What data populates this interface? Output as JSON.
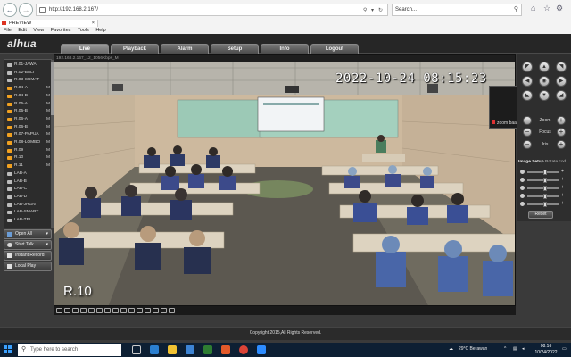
{
  "browser": {
    "url": "http://192.168.2.167/",
    "search_placeholder": "Search...",
    "tab_title": "PREVIEW",
    "menu": [
      "File",
      "Edit",
      "View",
      "Favorites",
      "Tools",
      "Help"
    ]
  },
  "app": {
    "logo": "alhua",
    "nav_tabs": [
      "Live",
      "Playback",
      "Alarm",
      "Setup",
      "Info",
      "Logout"
    ],
    "active_tab": "Live",
    "channels": [
      {
        "name": "R.01-JAWA",
        "m": ""
      },
      {
        "name": "R.02-BALI",
        "m": ""
      },
      {
        "name": "R.03-SUMAT",
        "m": ""
      },
      {
        "name": "R.04-A",
        "m": "M"
      },
      {
        "name": "R.04-B",
        "m": "M"
      },
      {
        "name": "R.05-A",
        "m": "M"
      },
      {
        "name": "R.05-B",
        "m": "M"
      },
      {
        "name": "R.06-A",
        "m": "M"
      },
      {
        "name": "R.06-B",
        "m": "M"
      },
      {
        "name": "R.07-PAPUA",
        "m": "M"
      },
      {
        "name": "R.08-LOMBO",
        "m": "M"
      },
      {
        "name": "R.09",
        "m": "M"
      },
      {
        "name": "R.10",
        "m": "M"
      },
      {
        "name": "R.11",
        "m": "M"
      },
      {
        "name": "LAB-A",
        "m": ""
      },
      {
        "name": "LAB-B",
        "m": ""
      },
      {
        "name": "LAB-C",
        "m": ""
      },
      {
        "name": "LAB-D",
        "m": ""
      },
      {
        "name": "LAB-JRGN",
        "m": ""
      },
      {
        "name": "LAB-SMART",
        "m": ""
      },
      {
        "name": "LAB-TEL",
        "m": ""
      }
    ],
    "buttons": {
      "open_all": "Open All",
      "start_talk": "Start Talk",
      "instant_record": "Instant Record",
      "local_play": "Local Play"
    },
    "video": {
      "info_bar": "192.168.2.167_12_1056Kbps_M",
      "timestamp": "2022-10-24 08:15:23",
      "room_label": "R.10"
    },
    "zoom": {
      "initial": "Z",
      "name": "zoom baa04"
    },
    "ptz": {
      "zoom_label": "Zoom",
      "focus_label": "Focus",
      "iris_label": "Iris"
    },
    "image_setup": {
      "tab1": "Image Setup",
      "tab2": "Rotate cod",
      "reset_label": "Reset",
      "sliders": [
        0.55,
        0.55,
        0.55,
        0.55,
        0.55
      ]
    },
    "copyright": "Copyright 2015,All Rights Reserved."
  },
  "taskbar": {
    "search_placeholder": "Type here to search",
    "weather": "29°C  Berawan",
    "time": "08:16",
    "date": "10/24/2022"
  },
  "colors": {
    "zoom_avatar": "#13a3a8",
    "taskbar": "#0d1f33",
    "app_bg": "#3a3a3a"
  }
}
